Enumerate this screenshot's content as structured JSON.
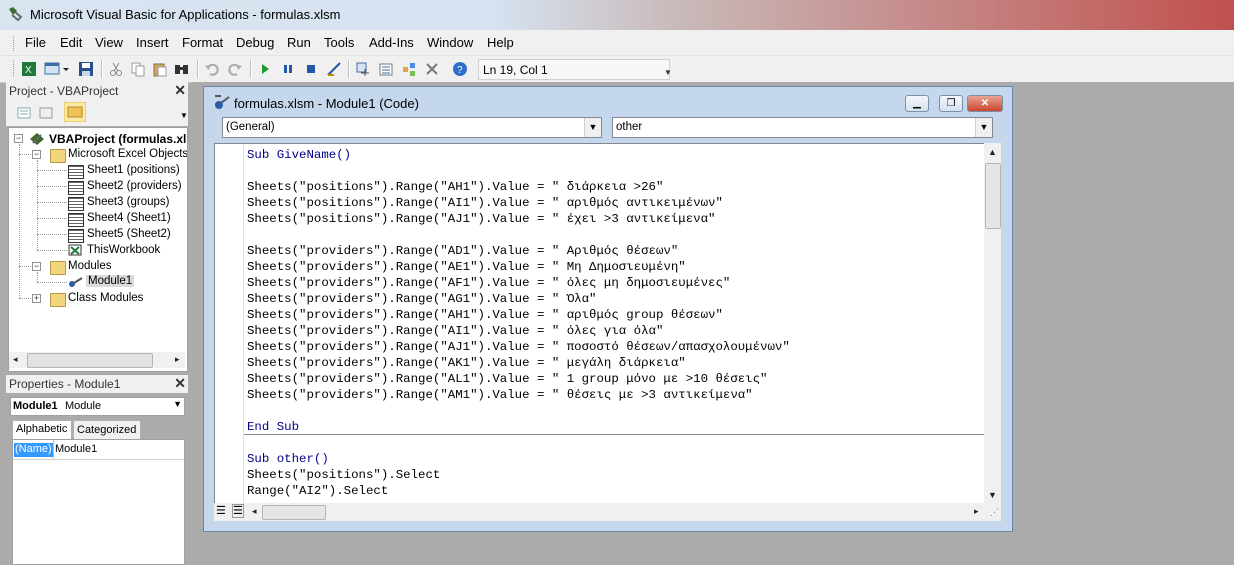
{
  "window": {
    "title": "Microsoft Visual Basic for Applications - formulas.xlsm"
  },
  "menu": [
    "File",
    "Edit",
    "View",
    "Insert",
    "Format",
    "Debug",
    "Run",
    "Tools",
    "Add-Ins",
    "Window",
    "Help"
  ],
  "toolbar": {
    "status": "Ln 19, Col 1",
    "icons": [
      "excel-icon",
      "insert-userform-icon",
      "save-icon",
      "cut-icon",
      "copy-icon",
      "paste-icon",
      "find-icon",
      "undo-icon",
      "redo-icon",
      "run-icon",
      "break-icon",
      "reset-icon",
      "design-mode-icon",
      "project-explorer-icon",
      "properties-icon",
      "object-browser-icon",
      "toolbox-icon",
      "help-icon"
    ]
  },
  "project_panel": {
    "title": "Project - VBAProject",
    "root": "VBAProject (formulas.xls",
    "excel_objects_folder": "Microsoft Excel Objects",
    "sheets": [
      "Sheet1 (positions)",
      "Sheet2 (providers)",
      "Sheet3 (groups)",
      "Sheet4 (Sheet1)",
      "Sheet5 (Sheet2)",
      "ThisWorkbook"
    ],
    "modules_folder": "Modules",
    "module": "Module1",
    "class_modules_folder": "Class Modules"
  },
  "properties_panel": {
    "title": "Properties - Module1",
    "object_name": "Module1",
    "object_type": "Module",
    "tabs": [
      "Alphabetic",
      "Categorized"
    ],
    "property_name": "(Name)",
    "property_value": "Module1"
  },
  "code_window": {
    "title": "formulas.xlsm - Module1 (Code)",
    "object_combo": "(General)",
    "procedure_combo": "other",
    "proc1": {
      "header": "Sub GiveName()",
      "lines_a": [
        "Sheets(\"positions\").Range(\"AH1\").Value = \" διάρκεια >26\"",
        "Sheets(\"positions\").Range(\"AI1\").Value = \" αριθμός αντικειμένων\"",
        "Sheets(\"positions\").Range(\"AJ1\").Value = \" έχει >3 αντικείμενα\""
      ],
      "lines_b": [
        "Sheets(\"providers\").Range(\"AD1\").Value = \" Αριθμός θέσεων\"",
        "Sheets(\"providers\").Range(\"AE1\").Value = \" Μη Δημοσιευμένη\"",
        "Sheets(\"providers\").Range(\"AF1\").Value = \" όλες μη δημοσιευμένες\"",
        "Sheets(\"providers\").Range(\"AG1\").Value = \" Όλα\"",
        "Sheets(\"providers\").Range(\"AH1\").Value = \" αριθμός group θέσεων\"",
        "Sheets(\"providers\").Range(\"AI1\").Value = \" όλες για όλα\"",
        "Sheets(\"providers\").Range(\"AJ1\").Value = \" ποσοστό θέσεων/απασχολουμένων\"",
        "Sheets(\"providers\").Range(\"AK1\").Value = \" μεγάλη διάρκεια\"",
        "Sheets(\"providers\").Range(\"AL1\").Value = \" 1 group μόνο με >10 θέσεις\"",
        "Sheets(\"providers\").Range(\"AM1\").Value = \" θέσεις με >3 αντικείμενα\""
      ],
      "footer": "End Sub"
    },
    "proc2": {
      "header": "Sub other()",
      "lines": [
        "Sheets(\"positions\").Select",
        "Range(\"AI2\").Select"
      ]
    }
  }
}
